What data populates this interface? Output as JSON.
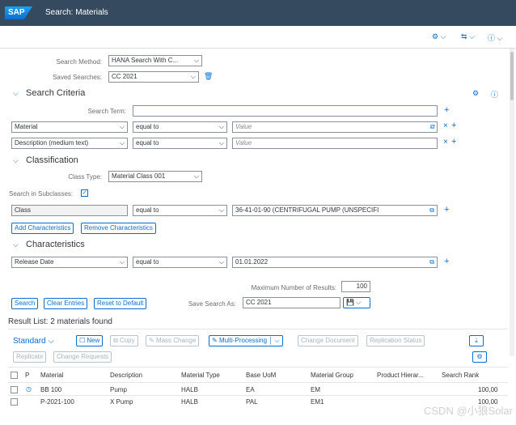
{
  "shell": {
    "logo": "SAP",
    "title": "Search: Materials"
  },
  "top_toolbar": {
    "icons": [
      "gear-icon",
      "transport-icon",
      "help-icon"
    ]
  },
  "search_method": {
    "label": "Search Method:",
    "value": "HANA Search With C..."
  },
  "saved_searches": {
    "label": "Saved Searches:",
    "value": "CC 2021"
  },
  "search_criteria": {
    "title": "Search Criteria",
    "search_term_label": "Search Term:",
    "rows": [
      {
        "field": "Material",
        "op": "equal to",
        "placeholder": "Value"
      },
      {
        "field": "Description (medium text)",
        "op": "equal to",
        "placeholder": "Value"
      }
    ]
  },
  "classification": {
    "title": "Classification",
    "class_type_label": "Class Type:",
    "class_type_value": "Material Class 001",
    "subclasses_label": "Search in Subclasses:",
    "row": {
      "field": "Class",
      "op": "equal to",
      "value": "36-41-01-90 (CENTRIFUGAL PUMP (UNSPECIFI"
    },
    "add_label": "Add Characteristics",
    "remove_label": "Remove Characteristics"
  },
  "characteristics": {
    "title": "Characteristics",
    "row": {
      "field": "Release Date",
      "op": "equal to",
      "value": "01.01.2022"
    }
  },
  "max_results": {
    "label": "Maximum Number of Results:",
    "value": "100"
  },
  "actions": {
    "search": "Search",
    "clear": "Clear Entries",
    "reset": "Reset to Default"
  },
  "save_search": {
    "label": "Save Search As:",
    "value": "CC 2021"
  },
  "result": {
    "title": "Result List: 2 materials found",
    "variant": "Standard",
    "buttons": {
      "new": "New",
      "copy": "Copy",
      "mass_change": "Mass Change",
      "multi_processing": "Multi-Processing",
      "change_document": "Change Document",
      "replication_status": "Replication Status",
      "replicate": "Replicate",
      "change_requests": "Change Requests"
    },
    "columns": [
      "P",
      "Material",
      "Description",
      "Material Type",
      "Base UoM",
      "Material Group",
      "Product Hierar...",
      "Search Rank"
    ],
    "rows": [
      {
        "material": "BB 100",
        "description": "Pump",
        "type": "HALB",
        "uom": "EA",
        "group": "EM",
        "hierarchy": "",
        "rank": "100,00"
      },
      {
        "material": "P-2021-100",
        "description": "X Pump",
        "type": "HALB",
        "uom": "PAL",
        "group": "EM1",
        "hierarchy": "",
        "rank": "100,00"
      }
    ]
  },
  "watermark": "CSDN @小狼Solar"
}
